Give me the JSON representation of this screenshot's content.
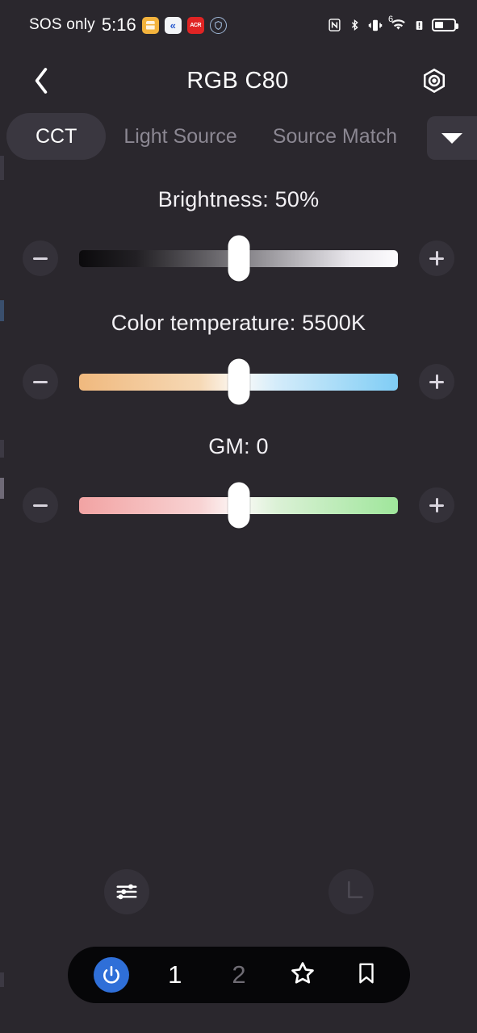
{
  "statusbar": {
    "carrier": "SOS only",
    "time": "5:16",
    "app_icons": [
      {
        "name": "notes-app-icon",
        "label": ""
      },
      {
        "name": "messenger-app-icon",
        "label": "«"
      },
      {
        "name": "acr-recorder-app-icon",
        "label": "ACR"
      },
      {
        "name": "shield-app-icon",
        "label": "ⓣ"
      }
    ],
    "system_icons": [
      "nfc-icon",
      "bluetooth-icon",
      "vibrate-icon",
      "wifi-6-icon",
      "alert-icon",
      "battery-icon"
    ],
    "wifi_generation": "6",
    "battery_level_percent": 45
  },
  "header": {
    "back_label": "‹",
    "title": "RGB C80",
    "settings_label": "settings"
  },
  "tabs": {
    "items": [
      {
        "label": "CCT",
        "active": true
      },
      {
        "label": "Light Source",
        "active": false
      },
      {
        "label": "Source Match",
        "active": false
      }
    ],
    "more_label": "▼"
  },
  "controls": [
    {
      "id": "brightness",
      "label": "Brightness: 50%",
      "value": 50,
      "unit": "%",
      "min": 0,
      "max": 100,
      "thumb_percent": 50,
      "decrease_label": "−",
      "increase_label": "+",
      "gradient_from": "#0b0a0c",
      "gradient_to": "#fdfcfe"
    },
    {
      "id": "color-temperature",
      "label": "Color temperature: 5500K",
      "value": 5500,
      "unit": "K",
      "min": 2500,
      "max": 8500,
      "thumb_percent": 50,
      "decrease_label": "−",
      "increase_label": "+",
      "gradient_from": "#f0b97e",
      "gradient_to": "#7fcdf5"
    },
    {
      "id": "gm",
      "label": "GM: 0",
      "value": 0,
      "unit": "",
      "min": -100,
      "max": 100,
      "thumb_percent": 50,
      "decrease_label": "−",
      "increase_label": "+",
      "gradient_from": "#f2a3a3",
      "gradient_to": "#9fe69b"
    }
  ],
  "tools": {
    "sliders_label": "sliders",
    "axis_label": "axis"
  },
  "bottombar": {
    "power_label": "power",
    "preset_one": "1",
    "preset_two": "2",
    "favorite_label": "favorite",
    "bookmark_label": "bookmark"
  },
  "colors": {
    "background": "#2a272d",
    "surface": "#343139",
    "accent_blue": "#2f6fd8",
    "bottom_bar": "#060608",
    "text_primary": "#ffffff",
    "text_muted": "#8b8792"
  }
}
